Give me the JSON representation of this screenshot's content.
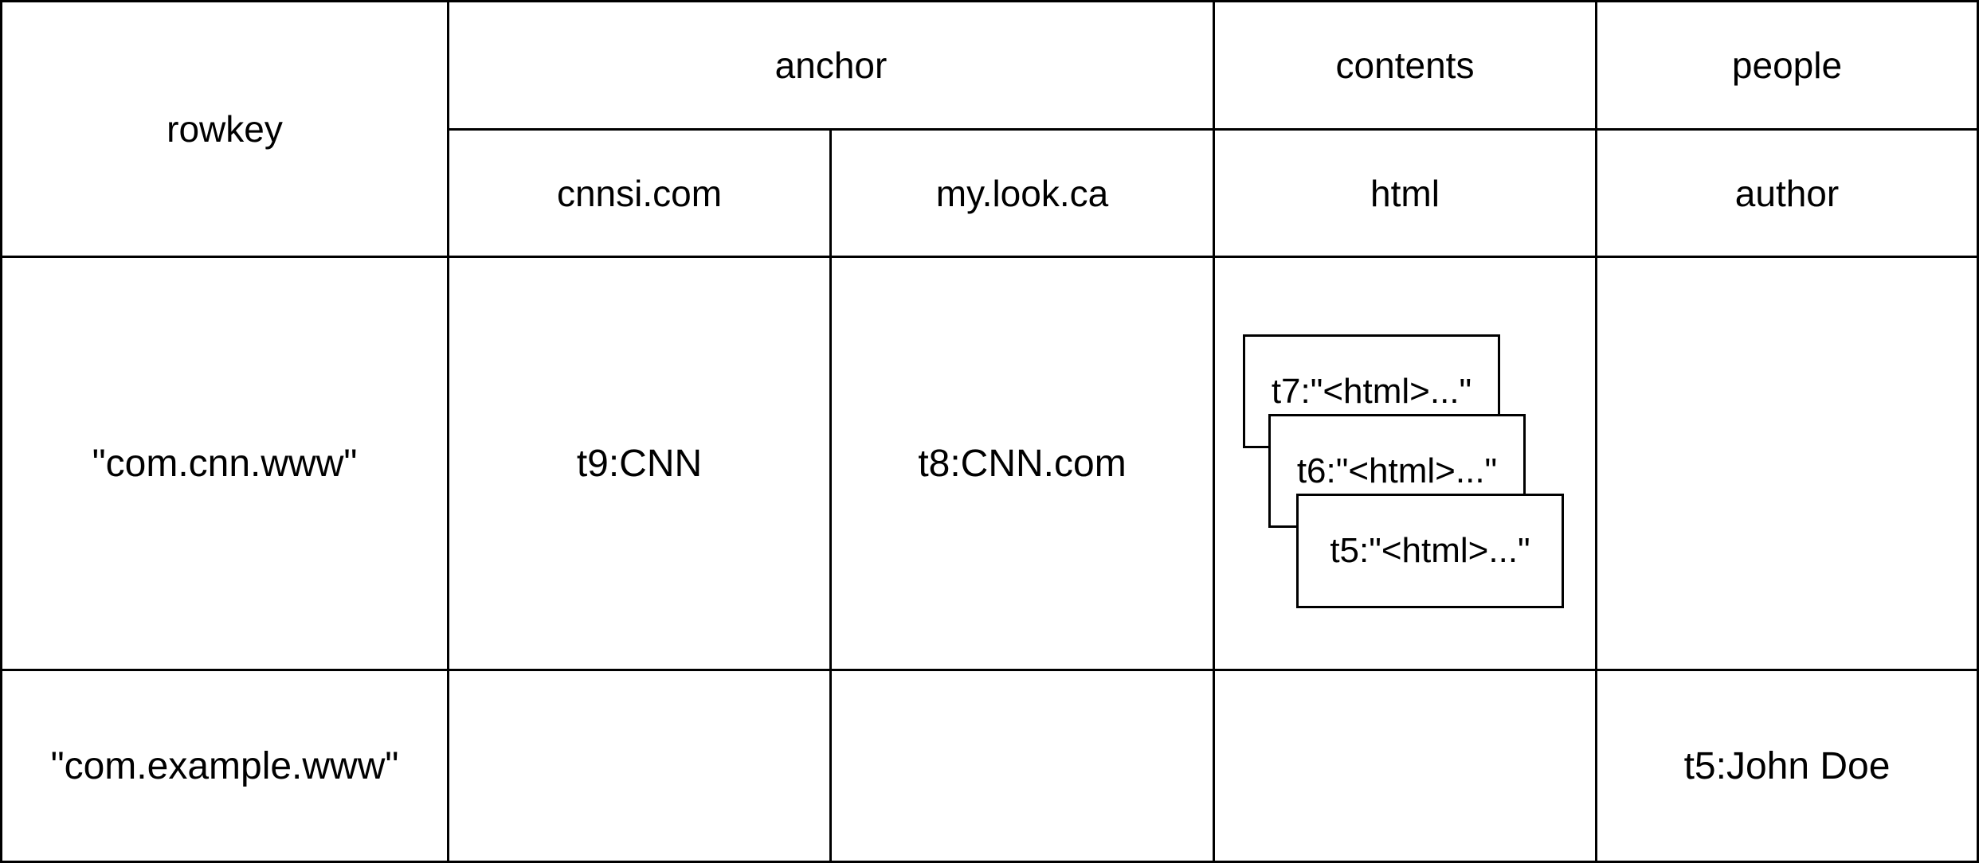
{
  "table": {
    "rowkey_header": "rowkey",
    "families": {
      "anchor": "anchor",
      "contents": "contents",
      "people": "people"
    },
    "qualifiers": {
      "cnnsi": "cnnsi.com",
      "mylook": "my.look.ca",
      "html": "html",
      "author": "author"
    },
    "rows": [
      {
        "key": "\"com.cnn.www\"",
        "anchor_cnnsi": "t9:CNN",
        "anchor_mylook": "t8:CNN.com",
        "contents_html_versions": [
          "t7:\"<html>...\"",
          "t6:\"<html>...\"",
          "t5:\"<html>...\""
        ],
        "people_author": ""
      },
      {
        "key": "\"com.example.www\"",
        "anchor_cnnsi": "",
        "anchor_mylook": "",
        "contents_html_versions": [],
        "people_author": "t5:John Doe"
      }
    ]
  }
}
